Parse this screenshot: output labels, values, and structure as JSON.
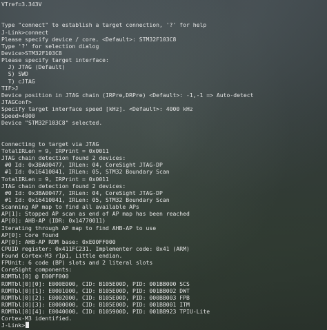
{
  "terminal": {
    "lines": [
      "VTref=3.343V",
      "",
      "",
      "Type \"connect\" to establish a target connection, '?' for help",
      "J-Link>connect",
      "Please specify device / core. <Default>: STM32F103C8",
      "Type '?' for selection dialog",
      "Device>STM32F103C8",
      "Please specify target interface:",
      "  J) JTAG (Default)",
      "  S) SWD",
      "  T) cJTAG",
      "TIF>J",
      "Device position in JTAG chain (IRPre,DRPre) <Default>: -1,-1 => Auto-detect",
      "JTAGConf>",
      "Specify target interface speed [kHz]. <Default>: 4000 kHz",
      "Speed>4000",
      "Device \"STM32F103C8\" selected.",
      "",
      "",
      "Connecting to target via JTAG",
      "TotalIRLen = 9, IRPrint = 0x0011",
      "JTAG chain detection found 2 devices:",
      " #0 Id: 0x3BA00477, IRLen: 04, CoreSight JTAG-DP",
      " #1 Id: 0x16410041, IRLen: 05, STM32 Boundary Scan",
      "TotalIRLen = 9, IRPrint = 0x0011",
      "JTAG chain detection found 2 devices:",
      " #0 Id: 0x3BA00477, IRLen: 04, CoreSight JTAG-DP",
      " #1 Id: 0x16410041, IRLen: 05, STM32 Boundary Scan",
      "Scanning AP map to find all available APs",
      "AP[1]: Stopped AP scan as end of AP map has been reached",
      "AP[0]: AHB-AP (IDR: 0x14770011)",
      "Iterating through AP map to find AHB-AP to use",
      "AP[0]: Core found",
      "AP[0]: AHB-AP ROM base: 0xE00FF000",
      "CPUID register: 0x411FC231. Implementer code: 0x41 (ARM)",
      "Found Cortex-M3 r1p1, Little endian.",
      "FPUnit: 6 code (BP) slots and 2 literal slots",
      "CoreSight components:",
      "ROMTbl[0] @ E00FF000",
      "ROMTbl[0][0]: E000E000, CID: B105E00D, PID: 001BB000 SCS",
      "ROMTbl[0][1]: E0001000, CID: B105E00D, PID: 001BB002 DWT",
      "ROMTbl[0][2]: E0002000, CID: B105E00D, PID: 000BB003 FPB",
      "ROMTbl[0][3]: E0000000, CID: B105E00D, PID: 001BB001 ITM",
      "ROMTbl[0][4]: E0040000, CID: B105900D, PID: 001BB923 TPIU-Lite",
      "Cortex-M3 identified.",
      "J-Link>"
    ]
  }
}
